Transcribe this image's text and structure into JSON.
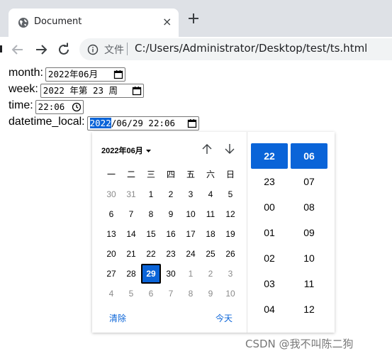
{
  "browser": {
    "tab_title": "Document",
    "tab_close_glyph": "×",
    "url_scheme": "文件",
    "url": "C:/Users/Administrator/Desktop/test/ts.html"
  },
  "form": {
    "month": {
      "label": "month:",
      "value": "2022年06月"
    },
    "week": {
      "label": "week:",
      "value": "2022 年第 23 周"
    },
    "time": {
      "label": "time:",
      "value": "22:06"
    },
    "datetime_local": {
      "label": "datetime_local:",
      "year_selected": "2022",
      "rest": "/06/29 22:06"
    }
  },
  "picker": {
    "month_title": "2022年06月",
    "weekdays": [
      "一",
      "二",
      "三",
      "四",
      "五",
      "六",
      "日"
    ],
    "weeks": [
      [
        "30",
        "31",
        "1",
        "2",
        "3",
        "4",
        "5"
      ],
      [
        "6",
        "7",
        "8",
        "9",
        "10",
        "11",
        "12"
      ],
      [
        "13",
        "14",
        "15",
        "16",
        "17",
        "18",
        "19"
      ],
      [
        "20",
        "21",
        "22",
        "23",
        "24",
        "25",
        "26"
      ],
      [
        "27",
        "28",
        "29",
        "30",
        "1",
        "2",
        "3"
      ],
      [
        "4",
        "5",
        "6",
        "7",
        "8",
        "9",
        "10"
      ]
    ],
    "selected_day": "29",
    "clear_label": "清除",
    "today_label": "今天",
    "hours": [
      "22",
      "23",
      "00",
      "01",
      "02",
      "03",
      "04"
    ],
    "minutes": [
      "06",
      "07",
      "08",
      "09",
      "10",
      "11",
      "12"
    ],
    "selected_hour": "22",
    "selected_minute": "06"
  },
  "watermark": "CSDN @我不叫陈二狗",
  "colors": {
    "accent": "#0a64d8",
    "tabstrip": "#dee1e6",
    "omnibox": "#f1f3f4"
  },
  "icons": [
    "globe-icon",
    "close-icon",
    "plus-icon",
    "back-arrow-icon",
    "forward-arrow-icon",
    "reload-icon",
    "info-icon",
    "calendar-icon",
    "clock-icon",
    "chevron-down-icon",
    "arrow-up-icon",
    "arrow-down-icon"
  ]
}
